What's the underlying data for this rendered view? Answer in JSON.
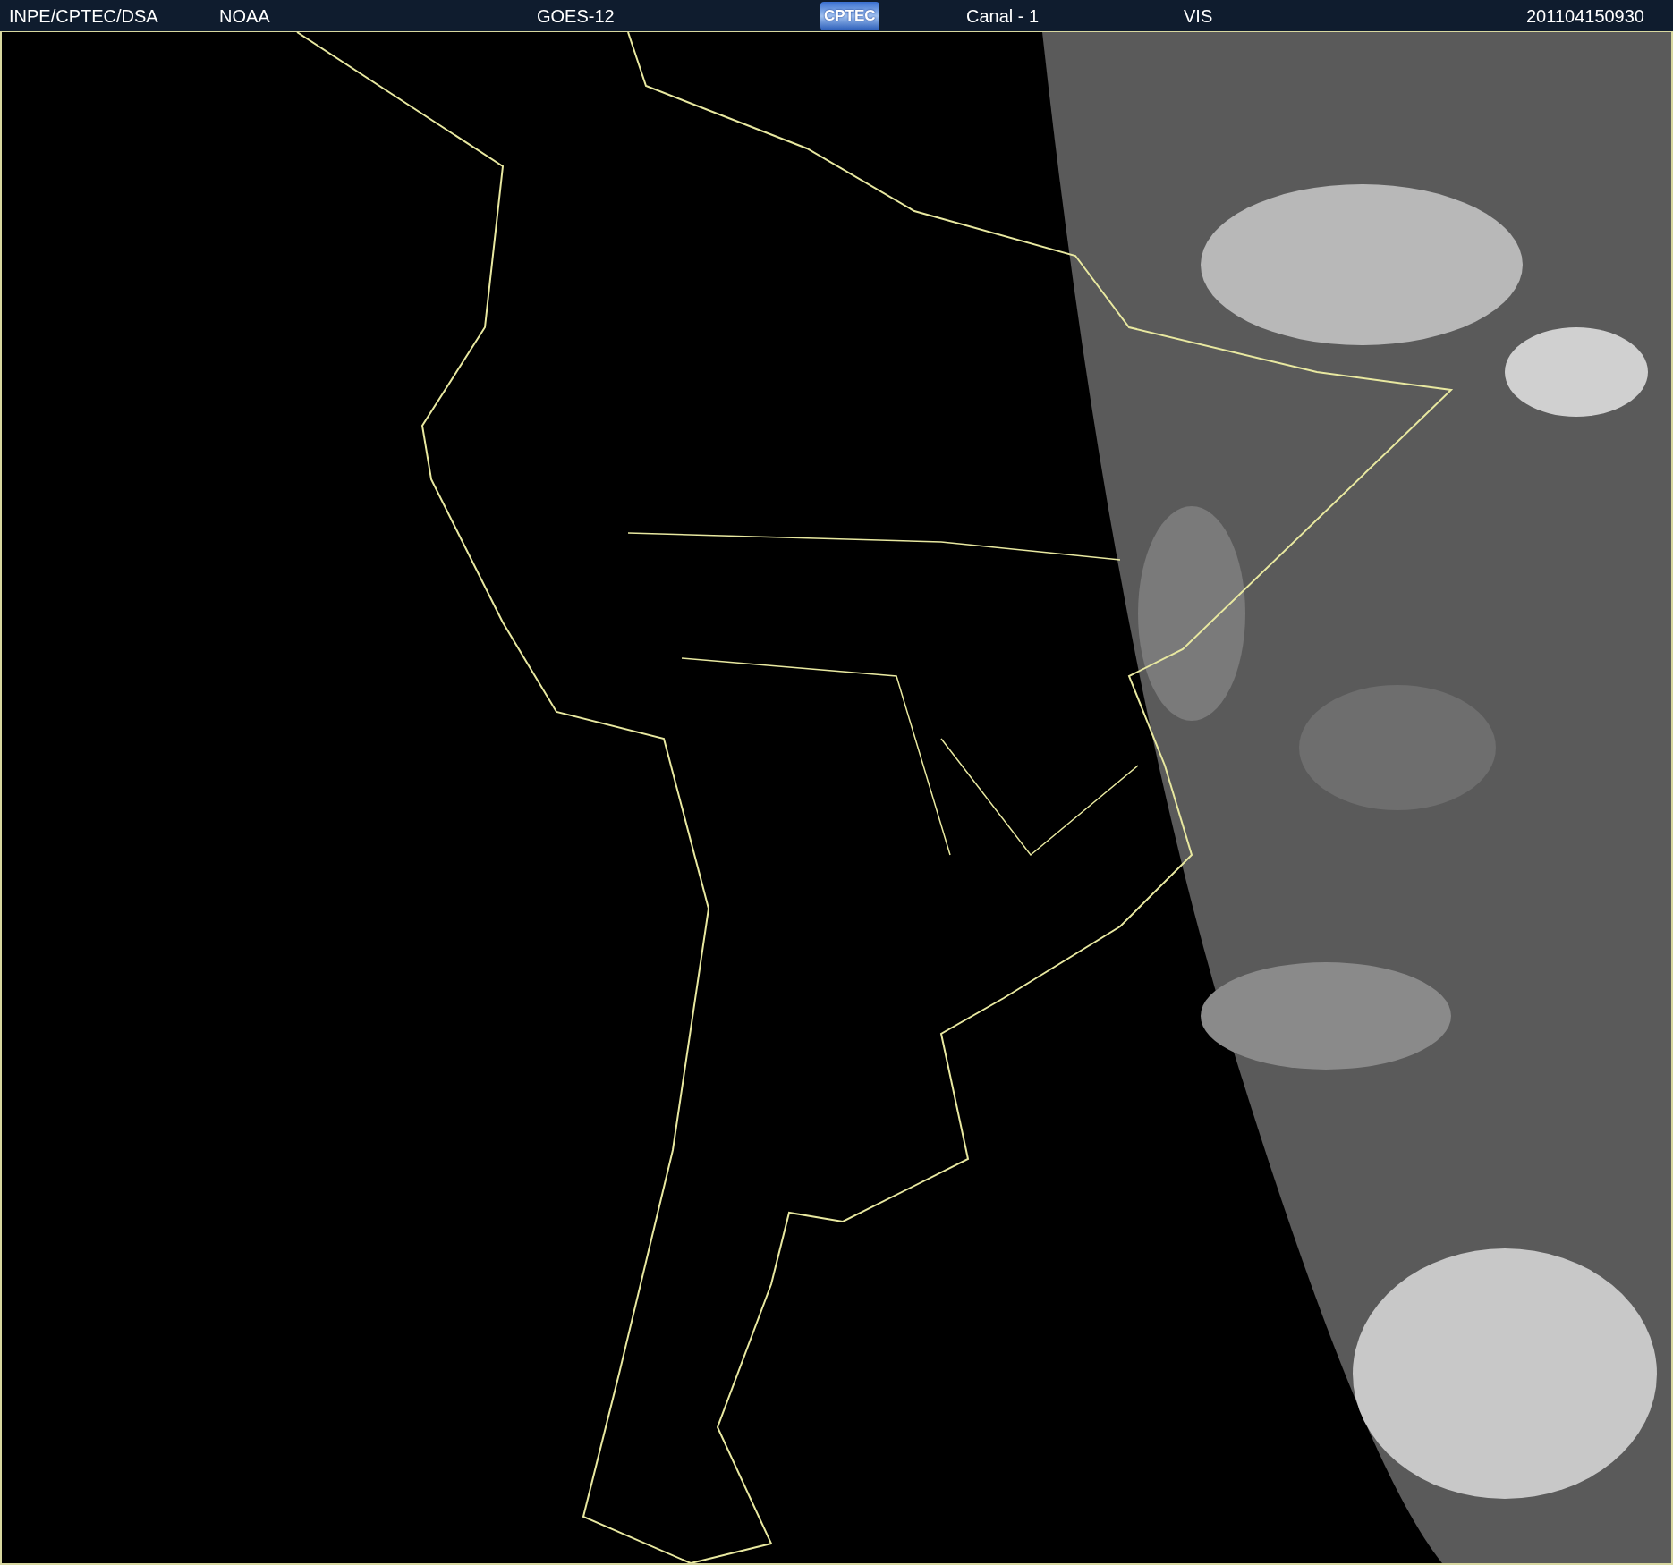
{
  "header": {
    "items": [
      {
        "kind": "text",
        "text": "INPE/CPTEC/DSA"
      },
      {
        "kind": "text",
        "text": "NOAA"
      },
      {
        "kind": "text",
        "text": "GOES-12"
      },
      {
        "kind": "logo",
        "text": "CPTEC"
      },
      {
        "kind": "text",
        "text": "Canal - 1"
      },
      {
        "kind": "text",
        "text": "VIS"
      },
      {
        "kind": "text",
        "text": "201104150930"
      }
    ]
  }
}
